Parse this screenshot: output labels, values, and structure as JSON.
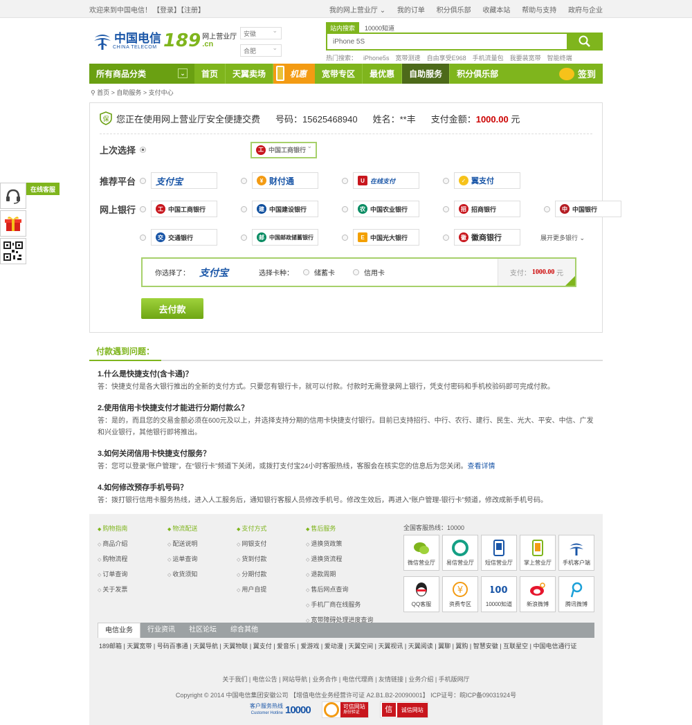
{
  "topbar": {
    "welcome": "欢迎来到中国电信！",
    "login": "【登录】",
    "register": "【注册】",
    "links": [
      "我的网上营业厅 ⌄",
      "我的订单",
      "积分俱乐部",
      "收藏本站",
      "帮助与支持",
      "政府与企业"
    ]
  },
  "header": {
    "logo_cn": "中国电信",
    "logo_en": "CHINA TELECOM",
    "logo_num": "189",
    "logo_sub1": "网上营业厅",
    "logo_sub2": ".cn",
    "province": "安徽",
    "city": "合肥",
    "search_tabs": [
      "站内搜索",
      "10000知道"
    ],
    "search_value": "iPhone 5S",
    "hot_label": "热门搜索：",
    "hot_items": [
      "iPhone5s",
      "宽带测速",
      "自由享受E968",
      "手机流量包",
      "我要装宽带",
      "智能终端"
    ]
  },
  "nav": {
    "all": "所有商品分类",
    "items": [
      "首页",
      "天翼卖场"
    ],
    "jihui": "机惠",
    "items2": [
      "宽带专区",
      "最优惠"
    ],
    "active": "自助服务",
    "items3": [
      "积分俱乐部"
    ],
    "signin": "签到"
  },
  "breadcrumb": [
    "首页",
    "自助服务",
    "支付中心"
  ],
  "summary": {
    "intro": "您正在使用网上营业厅安全便捷交费",
    "phone_label": "号码：",
    "phone": "15625468940",
    "name_label": "姓名：",
    "name": "**丰",
    "amount_label": "支付金额：",
    "amount": "1000.00",
    "unit": "元"
  },
  "rows": {
    "last": "上次选择",
    "platform": "推荐平台",
    "online": "网上银行"
  },
  "banks": {
    "last": "中国工商银行",
    "platforms": [
      "支付宝",
      "财付通",
      "在线支付",
      "翼支付"
    ],
    "row1": [
      "中国工商银行",
      "中国建设银行",
      "中国农业银行",
      "招商银行",
      "中国银行"
    ],
    "row2": [
      "交通银行",
      "中国邮政储蓄银行",
      "中国光大银行",
      "徽商银行"
    ],
    "more": "展开更多银行 ⌄"
  },
  "chosen": {
    "label": "你选择了：",
    "logo": "支付宝",
    "card_type": "选择卡种：",
    "opt1": "储蓄卡",
    "opt2": "信用卡",
    "pay_label": "支付：",
    "pay_amount": "1000.00",
    "pay_unit": "元"
  },
  "pay_button": "去付款",
  "faq": {
    "title": "付款遇到问题：",
    "items": [
      {
        "q": "1.什么是快捷支付(含卡通)？",
        "a": "答：快捷支付是各大银行推出的全新的支付方式。只要您有银行卡，就可以付款。付款时无需登录网上银行，凭支付密码和手机校验码即可完成付款。"
      },
      {
        "q": "2.使用信用卡快捷支付才能进行分期付款么？",
        "a": "答：是的，而且您的交易金额必须在600元及以上，并选择支持分期的信用卡快捷支付银行。目前已支持招行、中行、农行、建行、民生、光大、平安、中信、广发和兴业银行，其他银行即将推出。"
      },
      {
        "q": "3.如何关闭信用卡快捷支付服务？",
        "a": "答：您可以登录“账户管理”，在“银行卡”频道下关闭，或拨打支付宝24小时客服热线，客服会在核实您的信息后为您关闭。",
        "link": "查看详情"
      },
      {
        "q": "4.如何修改预存手机号码？",
        "a": "答：拨打银行信用卡服务热线，进入人工服务后，通知银行客服人员修改手机号。修改生效后，再进入“账户管理-银行卡”频道，修改成新手机号码。"
      }
    ]
  },
  "footer": {
    "cols": [
      {
        "h": "购物指南",
        "items": [
          "商品介绍",
          "购物流程",
          "订单查询",
          "关于发票"
        ]
      },
      {
        "h": "物流配送",
        "items": [
          "配送说明",
          "运单查询",
          "收货须知"
        ]
      },
      {
        "h": "支付方式",
        "items": [
          "网银支付",
          "货到付款",
          "分期付款",
          "用户自提"
        ]
      },
      {
        "h": "售后服务",
        "items": [
          "退换货政策",
          "退换货流程",
          "退款周期",
          "售后网点查询",
          "手机厂商在线服务",
          "宽带障碍处理进度查询"
        ]
      }
    ],
    "hotline": "全国客服热线：10000",
    "icons": [
      "微信营业厅",
      "易信营业厅",
      "短信营业厅",
      "掌上营业厅",
      "手机客户端",
      "QQ客服",
      "资费专区",
      "10000知道",
      "新浪微博",
      "腾讯微博"
    ],
    "tabs": [
      "电信业务",
      "行业资讯",
      "社区论坛",
      "综合其他"
    ],
    "links": "189邮箱 | 天翼宽带 | 号码百事通 | 天翼导航 | 天翼物联 | 翼支付 | 爱音乐 | 爱游戏 | 爱动漫 | 天翼空间 | 天翼视讯 | 天翼阅读 | 翼聊 | 翼购 | 智慧安徽 | 互联星空 | 中国电信通行证",
    "about": "关于我们 | 电信公告 | 网站导航 | 业务合作 | 电信代理商 | 友情链接 | 业务介绍 | 手机版网厅",
    "copyright": "Copyright © 2014 中国电信集团安徽公司 【增值电信业务经营许可证 A2.B1.B2-20090001】 ICP证号：皖ICP备09031924号",
    "badge1_top": "客户服务热线",
    "badge1_num": "10000",
    "badge1_en": "Customer Hotline",
    "badge2": "可信网站",
    "badge2_sub": "身份验证",
    "badge3": "诚信网站"
  },
  "side": {
    "online": "在线客服"
  }
}
